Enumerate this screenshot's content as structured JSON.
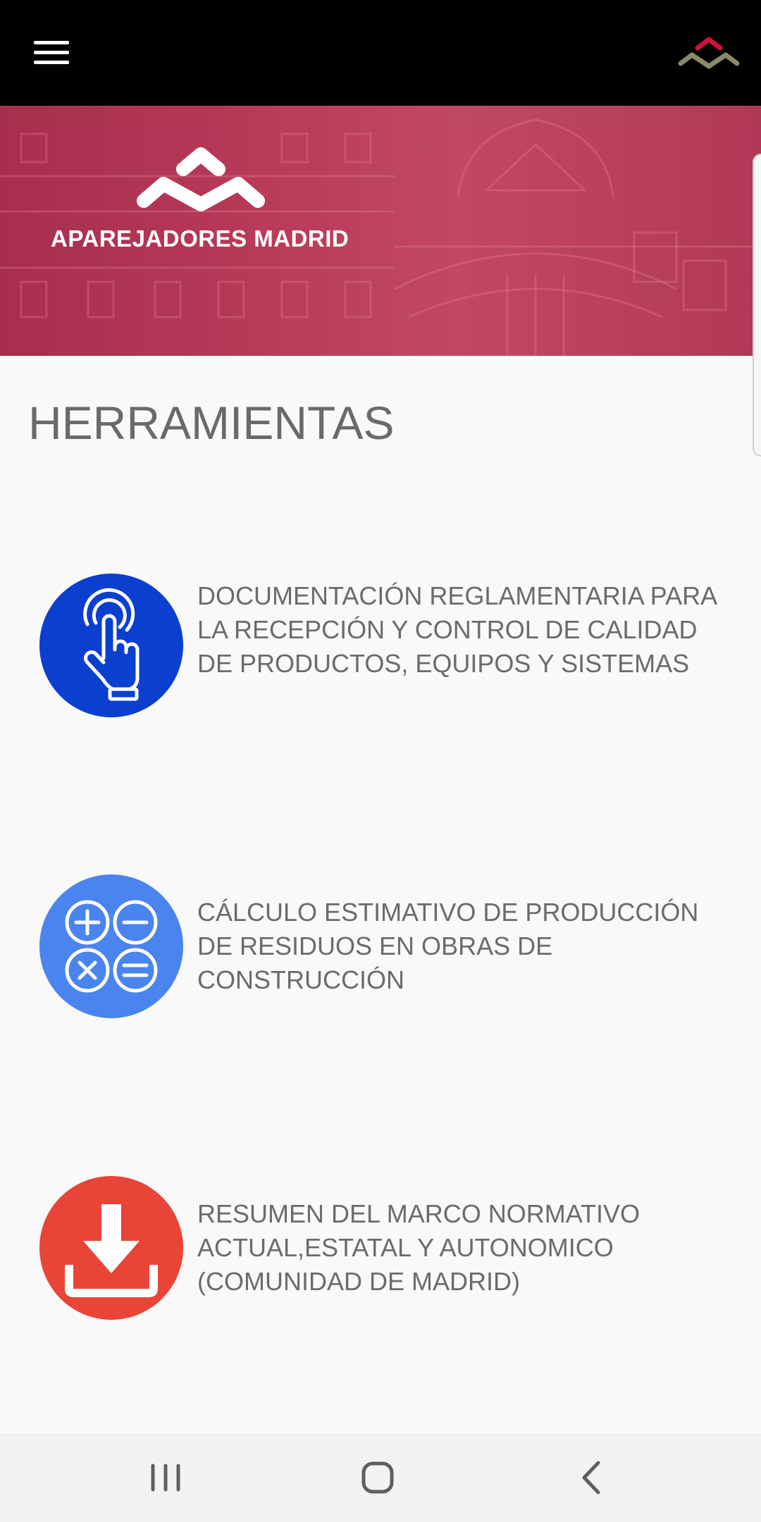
{
  "app_bar": {
    "menu_icon": "hamburger-menu-icon",
    "logo_icon": "aparejadores-logo-icon"
  },
  "banner": {
    "org_name": "APAREJADORES MADRID"
  },
  "page": {
    "title": "HERRAMIENTAS"
  },
  "tools": [
    {
      "label": "DOCUMENTACIÓN REGLAMENTARIA PARA LA RECEPCIÓN Y CONTROL DE CALIDAD DE PRODUCTOS, EQUIPOS Y SISTEMAS",
      "icon": "touch-hand-icon",
      "color": "#0a3fd0"
    },
    {
      "label": "CÁLCULO ESTIMATIVO DE PRODUCCIÓN DE RESIDUOS EN OBRAS DE CONSTRUCCIÓN",
      "icon": "calculator-operations-icon",
      "color": "#4a84ee"
    },
    {
      "label": "RESUMEN DEL MARCO NORMATIVO ACTUAL,ESTATAL Y AUTONOMICO (COMUNIDAD DE MADRID)",
      "icon": "download-icon",
      "color": "#e94438"
    }
  ],
  "nav": {
    "recent_icon": "recent-apps-icon",
    "home_icon": "home-icon",
    "back_icon": "back-icon"
  }
}
